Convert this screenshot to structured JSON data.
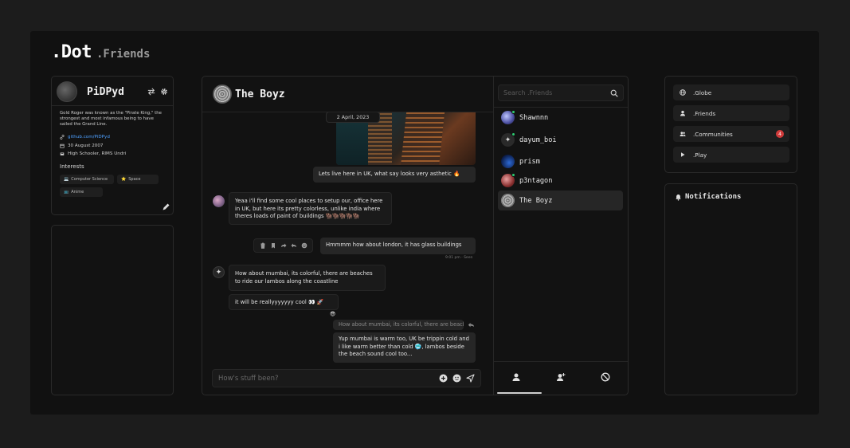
{
  "brand": {
    "name": ".Dot",
    "sub": ".Friends"
  },
  "profile": {
    "name": "PiDPyd",
    "bio": "Gold Roger was known as the \"Pirate King,\" the strongest and most infamous being to have sailed the Grand Line.",
    "link": "github.com/PiDPyd",
    "birthday": "30 August 2007",
    "school": "High Schooler, RIMS Undri",
    "interests_title": "Interests",
    "interests": [
      {
        "icon": "💻",
        "label": "Computer Science"
      },
      {
        "icon": "⭐",
        "label": "Space"
      },
      {
        "icon": "📺",
        "label": "Anime"
      }
    ]
  },
  "chat": {
    "title": "The Boyz",
    "date": "2 April, 2023",
    "messages": {
      "m1": "Lets live here in UK, what say looks very asthetic 🔥",
      "m2": "Yeaa i'll find some cool places to setup our, office here in UK, but here its pretty colorless, unlike india where theres loads of paint of buildings 🦬🦬🦬🦬🦬",
      "m3": "Hmmmm how about london, it has glass buildings",
      "m3_meta": "9:01 pm · Seen",
      "m4": "How about mumbai, its colorful, there are beaches to ride our lambos along the coastline",
      "m5": "it will be reallyyyyyyy cool 👀 🚀",
      "m5_emoji": "😎",
      "m6": "How about mumbai, its colorful, there are beaches to ride our lambos along the coastline",
      "m7": "Yup mumbai is warm too, UK be trippin cold and i like warm better than cold 🥶, lambos beside the beach sound cool too..."
    },
    "input_placeholder": "How's stuff been?"
  },
  "friends": {
    "search_placeholder": "Search .Friends",
    "list": [
      {
        "name": "Shawnnn",
        "online": true
      },
      {
        "name": "dayum_boi",
        "online": true
      },
      {
        "name": "prism",
        "online": false
      },
      {
        "name": "p3ntagon",
        "online": true
      },
      {
        "name": "The Boyz",
        "online": false
      }
    ]
  },
  "nav": {
    "items": [
      {
        "label": ".Globe",
        "icon": "globe-icon"
      },
      {
        "label": ".Friends",
        "icon": "person-icon"
      },
      {
        "label": ".Communities",
        "icon": "group-icon",
        "badge": "4"
      },
      {
        "label": ".Play",
        "icon": "play-icon"
      }
    ]
  },
  "notifications": {
    "title": "Notifications"
  },
  "colors": {
    "accent_online": "#2ecc71",
    "badge": "#d13b3b",
    "link": "#4ea0ff"
  }
}
